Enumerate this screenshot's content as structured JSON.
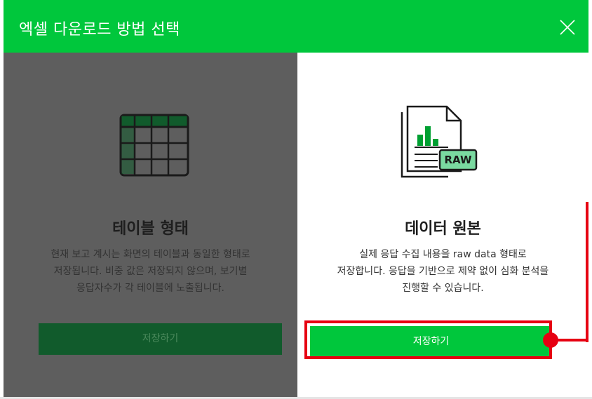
{
  "dialog": {
    "title": "엑셀 다운로드 방법 선택",
    "close_icon": "close-icon"
  },
  "option_table": {
    "icon": "table-icon",
    "title": "테이블 형태",
    "desc_lines": [
      "현재 보고 계시는 화면의 테이블과 동일한 형태로",
      "저장됩니다. 비중 값은 저장되지 않으며, 보기별",
      "응답자수가 각 테이블에 노출됩니다."
    ],
    "button_label": "저장하기"
  },
  "option_raw": {
    "icon": "raw-document-icon",
    "icon_badge": "RAW",
    "title": "데이터 원본",
    "desc_lines": [
      "실제 응답 수집 내용을 raw data 형태로",
      "저장합니다. 응답을 기반으로 제약 없이 심화 분석을",
      "진행할 수 있습니다."
    ],
    "button_label": "저장하기"
  },
  "colors": {
    "brand_green": "#00c73c",
    "dim_overlay": "#5e5e5e",
    "highlight_red": "#e60012"
  }
}
